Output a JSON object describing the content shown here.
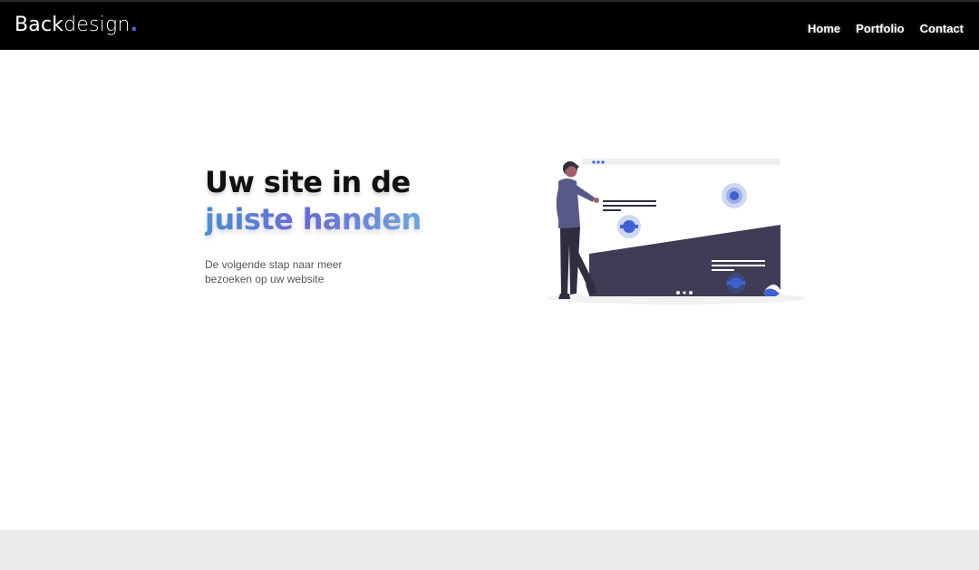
{
  "header": {
    "logo_bold": "Back",
    "logo_light": "design",
    "logo_dot": "."
  },
  "nav": {
    "items": [
      "Home",
      "Portfolio",
      "Contact"
    ]
  },
  "hero": {
    "title_line1": "Uw site in de",
    "title_line2": "juiste handen",
    "subtitle": "De volgende stap naar meer bezoeken op uw website"
  },
  "colors": {
    "header_bg": "#000000",
    "accent": "#4a6cd6",
    "gradient_start": "#4d8fd0",
    "gradient_end": "#6fa6d8",
    "illustration_dark": "#3f3d56",
    "footer_band": "#ebebeb"
  },
  "illustration": {
    "icon": "web-developer-illustration"
  }
}
